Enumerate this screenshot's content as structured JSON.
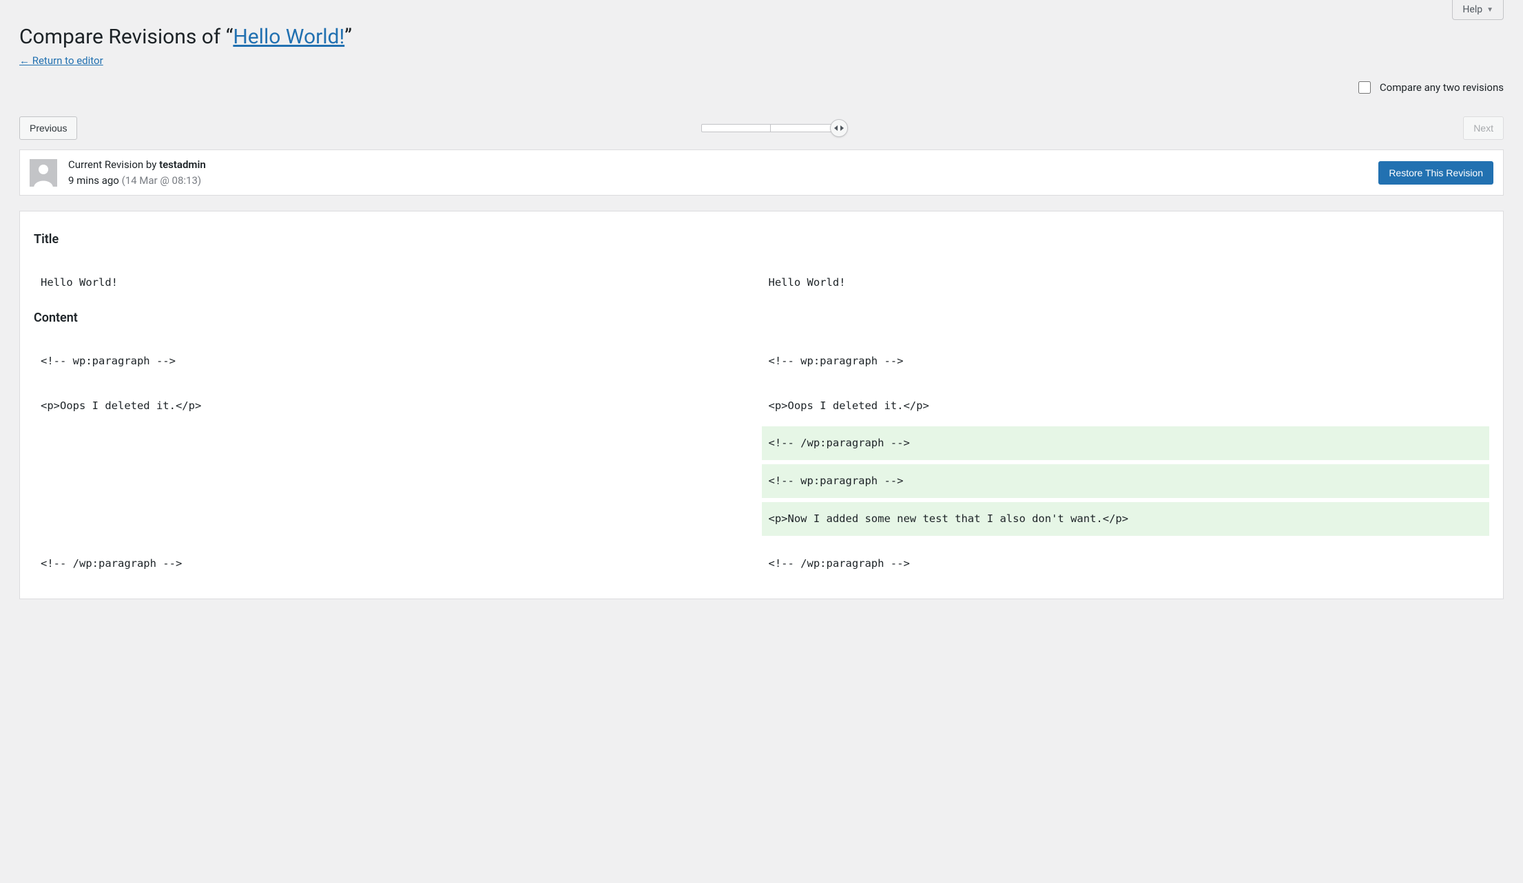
{
  "help": {
    "label": "Help"
  },
  "heading": {
    "prefix": "Compare Revisions of “",
    "link_text": "Hello World!",
    "suffix": "”",
    "return_link": "← Return to editor"
  },
  "compare_any": {
    "label": "Compare any two revisions",
    "checked": false
  },
  "toolbar": {
    "previous": "Previous",
    "next": "Next",
    "next_disabled": true
  },
  "meta": {
    "byline_prefix": "Current Revision by ",
    "author": "testadmin",
    "relative_time": "9 mins ago",
    "absolute_time": "(14 Mar @ 08:13)",
    "restore_label": "Restore This Revision"
  },
  "diff": {
    "sections": [
      {
        "heading": "Title",
        "rows": [
          {
            "left": "Hello World!",
            "right": "Hello World!",
            "left_kind": "ctx",
            "right_kind": "ctx"
          }
        ]
      },
      {
        "heading": "Content",
        "rows": [
          {
            "left": "<!-- wp:paragraph -->",
            "right": "<!-- wp:paragraph -->",
            "left_kind": "ctx",
            "right_kind": "ctx"
          },
          {
            "spacer": true
          },
          {
            "left": "<p>Oops I deleted it.</p>",
            "right": "<p>Oops I deleted it.</p>",
            "left_kind": "ctx",
            "right_kind": "ctx"
          },
          {
            "left": "",
            "right": "<!-- /wp:paragraph -->",
            "left_kind": "empty",
            "right_kind": "add"
          },
          {
            "left": "",
            "right": "<!-- wp:paragraph -->",
            "left_kind": "empty",
            "right_kind": "add"
          },
          {
            "left": "",
            "right": "<p>Now I added some new test that I also don't want.</p>",
            "left_kind": "empty",
            "right_kind": "add"
          },
          {
            "spacer": true
          },
          {
            "left": "<!-- /wp:paragraph -->",
            "right": "<!-- /wp:paragraph -->",
            "left_kind": "ctx",
            "right_kind": "ctx"
          }
        ]
      }
    ]
  }
}
